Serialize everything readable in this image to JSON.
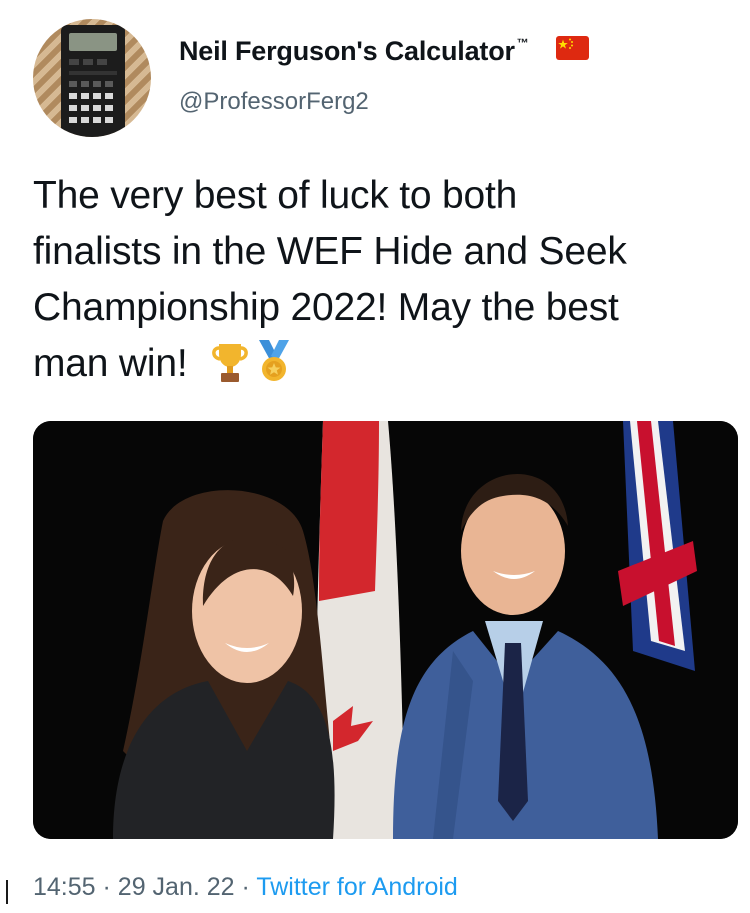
{
  "tweet": {
    "display_name": "Neil Ferguson's Calculator",
    "trademark": "™",
    "handle": "@ProfessorFerg2",
    "text_lines": [
      "The very best of luck to both",
      "finalists in the WEF Hide and Seek",
      "Championship 2022! May the best",
      "man win!"
    ],
    "emojis": [
      "trophy-icon",
      "medal-icon"
    ],
    "time": "14:55",
    "separator": "·",
    "date": "29 Jan. 22",
    "source": "Twitter for Android"
  },
  "icons": {
    "avatar": "calculator-icon",
    "name_badge": "china-flag-icon",
    "photo_flags": [
      "canada-flag",
      "uk-flag"
    ]
  },
  "colors": {
    "text": "#0f1419",
    "secondary": "#536471",
    "link": "#1d9bf0",
    "flag_red": "#de2910",
    "flag_yellow": "#ffde00"
  }
}
